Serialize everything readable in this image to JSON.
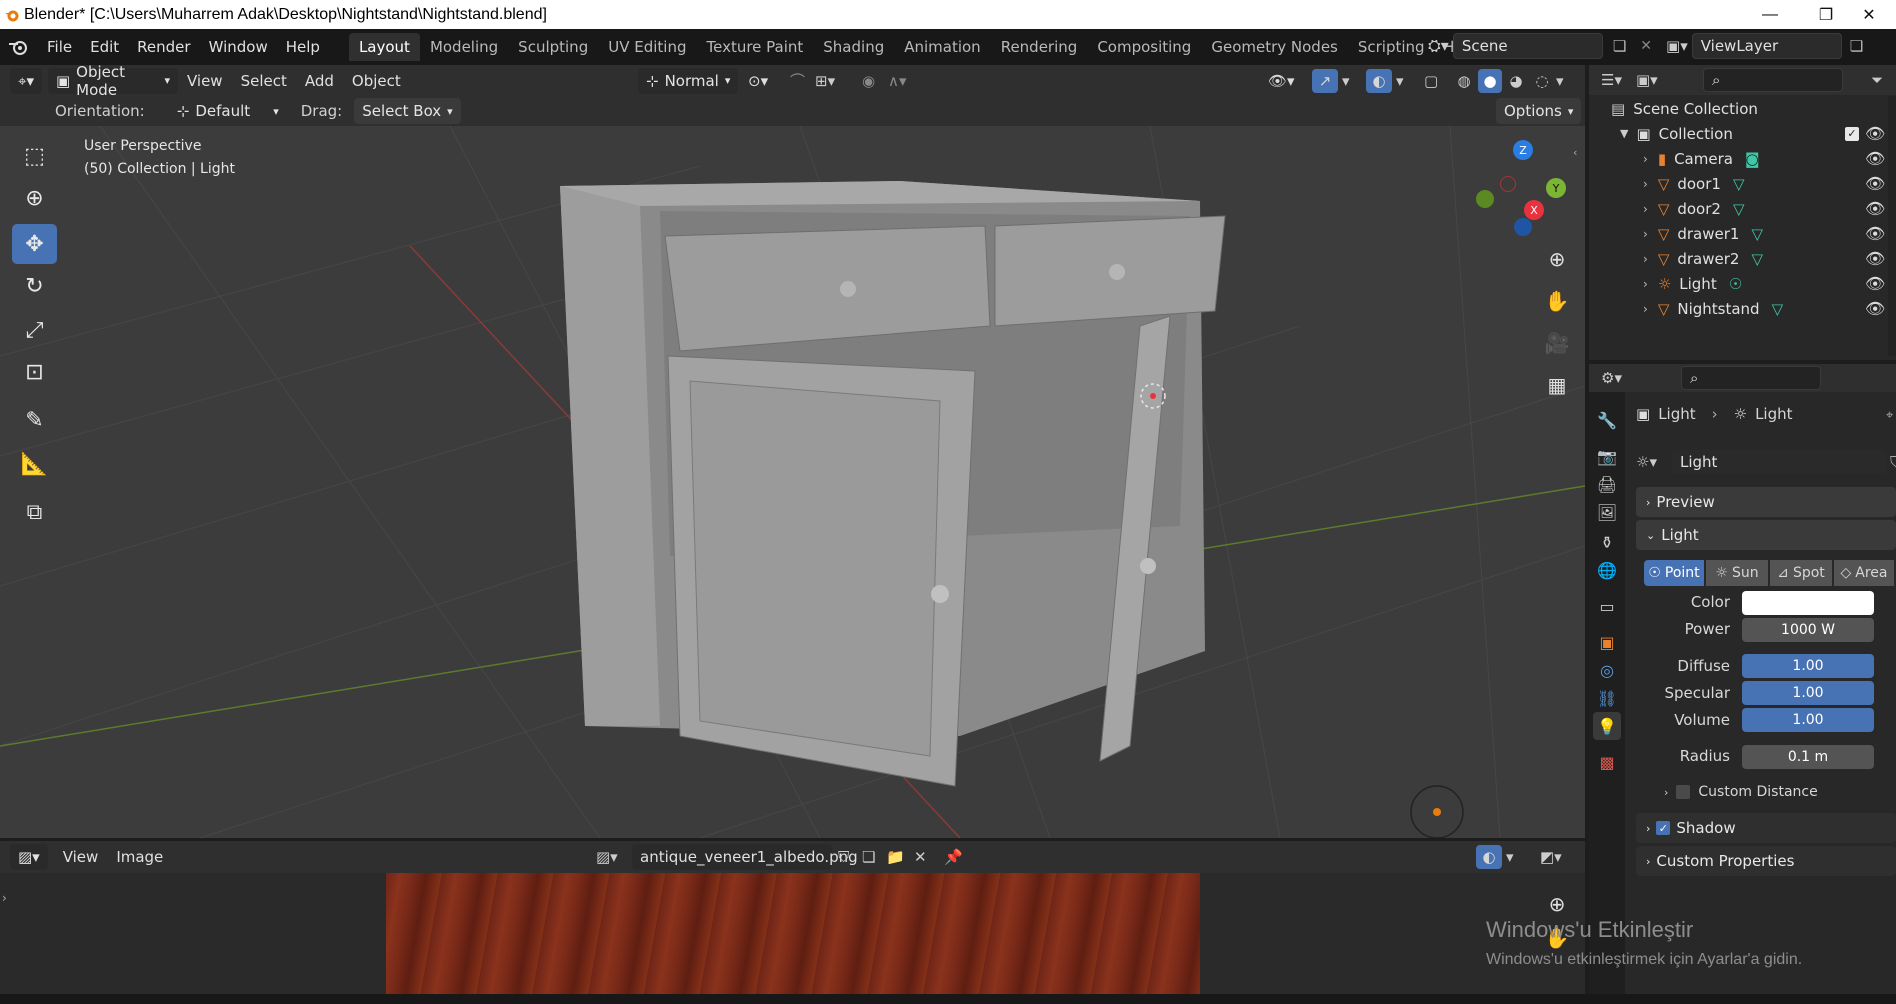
{
  "titlebar": {
    "title": "Blender* [C:\\Users\\Muharrem Adak\\Desktop\\Nightstand\\Nightstand.blend]",
    "minimize": "—",
    "maximize": "❐",
    "close": "✕"
  },
  "menu": {
    "items": [
      "File",
      "Edit",
      "Render",
      "Window",
      "Help"
    ]
  },
  "workspaces": [
    "Layout",
    "Modeling",
    "Sculpting",
    "UV Editing",
    "Texture Paint",
    "Shading",
    "Animation",
    "Rendering",
    "Compositing",
    "Geometry Nodes",
    "Scripting"
  ],
  "active_workspace": "Layout",
  "scene": {
    "name": "Scene",
    "view_layer": "ViewLayer"
  },
  "viewport_header": {
    "mode": "Object Mode",
    "view": "View",
    "select": "Select",
    "add": "Add",
    "object": "Object",
    "transform_orientation": "Normal"
  },
  "tool_header": {
    "orientation_label": "Orientation:",
    "orientation_value": "Default",
    "drag_label": "Drag:",
    "drag_value": "Select Box",
    "options": "Options"
  },
  "viewport": {
    "perspective": "User Perspective",
    "collection_info": "(50) Collection | Light"
  },
  "gizmo": {
    "x": "X",
    "y": "Y",
    "z": "Z"
  },
  "image_editor": {
    "view": "View",
    "image": "Image",
    "filename": "antique_veneer1_albedo.png"
  },
  "outliner": {
    "scene_collection": "Scene Collection",
    "collection": "Collection",
    "collection_truncated": "Collecti",
    "objects": [
      {
        "name": "Camera",
        "type": "camera"
      },
      {
        "name": "door1",
        "type": "mesh"
      },
      {
        "name": "door2",
        "type": "mesh"
      },
      {
        "name": "drawer1",
        "type": "mesh"
      },
      {
        "name": "drawer2",
        "type": "mesh"
      },
      {
        "name": "Light",
        "type": "light"
      },
      {
        "name": "Nightstand",
        "type": "mesh"
      }
    ]
  },
  "properties": {
    "breadcrumb_object": "Light",
    "breadcrumb_data": "Light",
    "datablock": "Light",
    "panels": {
      "preview": "Preview",
      "light": "Light",
      "custom_distance": "Custom Distance",
      "shadow": "Shadow",
      "custom_properties": "Custom Properties"
    },
    "light_types": [
      "Point",
      "Sun",
      "Spot",
      "Area"
    ],
    "active_light_type": "Point",
    "fields": {
      "color_label": "Color",
      "power_label": "Power",
      "power_value": "1000 W",
      "diffuse_label": "Diffuse",
      "diffuse_value": "1.00",
      "specular_label": "Specular",
      "specular_value": "1.00",
      "volume_label": "Volume",
      "volume_value": "1.00",
      "radius_label": "Radius",
      "radius_value": "0.1 m"
    },
    "shadow_checked": true,
    "custom_distance_checked": false
  },
  "watermark": {
    "line1": "Windows'u Etkinleştir",
    "line2": "Windows'u etkinleştirmek için Ayarlar'a gidin."
  },
  "colors": {
    "accent": "#4772b3",
    "mesh_icon": "#e9822f",
    "data_icon": "#3ec7a6",
    "axis_x": "#e8333f",
    "axis_y": "#7bb533",
    "axis_z": "#2a7de1"
  }
}
